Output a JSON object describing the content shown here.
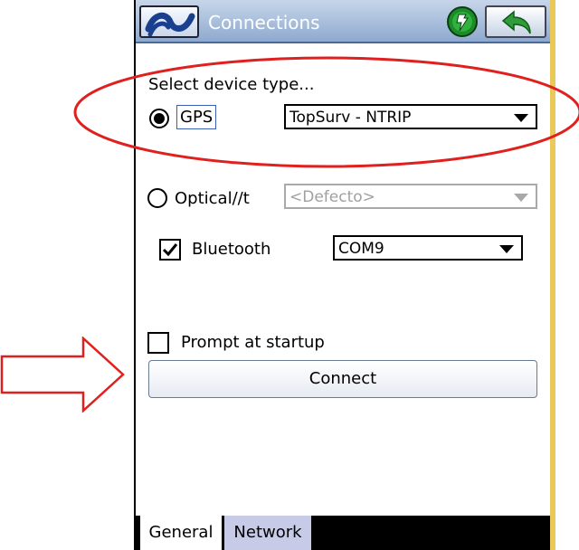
{
  "window": {
    "title": "Connections"
  },
  "device_type": {
    "label": "Select device type..."
  },
  "gps": {
    "label": "GPS",
    "selected": true,
    "config_value": "TopSurv - NTRIP"
  },
  "optical": {
    "label": "Optical//t",
    "selected": false,
    "config_value": "<Defecto>"
  },
  "bluetooth": {
    "label": "Bluetooth",
    "checked": true,
    "port_value": "COM9"
  },
  "prompt": {
    "label": "Prompt at startup",
    "checked": false
  },
  "connect": {
    "label": "Connect"
  },
  "tabs": [
    {
      "label": "General",
      "active": true
    },
    {
      "label": "Network",
      "active": false
    }
  ],
  "annotation_colors": {
    "highlight": "#e0201e"
  }
}
